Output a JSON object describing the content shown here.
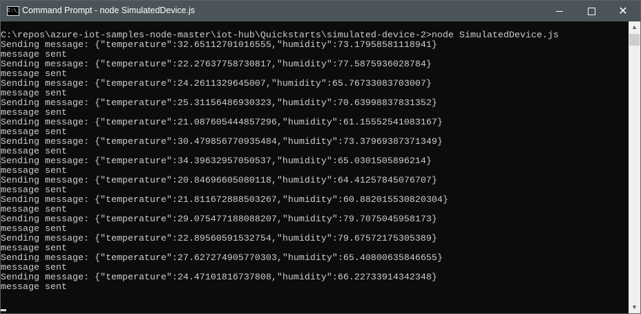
{
  "window": {
    "title": "Command Prompt - node  SimulatedDevice.js",
    "icon_text": "C:\\_"
  },
  "console": {
    "prompt": "C:\\repos\\azure-iot-samples-node-master\\iot-hub\\Quickstarts\\simulated-device-2>node SimulatedDevice.js",
    "lines": [
      "Sending message: {\"temperature\":32.65112701016555,\"humidity\":73.17958581118941}",
      "message sent",
      "Sending message: {\"temperature\":22.27637758730817,\"humidity\":77.5875936028784}",
      "message sent",
      "Sending message: {\"temperature\":24.2611329645007,\"humidity\":65.76733083703007}",
      "message sent",
      "Sending message: {\"temperature\":25.31156486930323,\"humidity\":70.63998837831352}",
      "message sent",
      "Sending message: {\"temperature\":21.087605444857296,\"humidity\":61.15552541083167}",
      "message sent",
      "Sending message: {\"temperature\":30.479856770935484,\"humidity\":73.37969387371349}",
      "message sent",
      "Sending message: {\"temperature\":34.39632957050537,\"humidity\":65.0301505896214}",
      "message sent",
      "Sending message: {\"temperature\":20.84696605080118,\"humidity\":64.41257845076707}",
      "message sent",
      "Sending message: {\"temperature\":21.811672888503267,\"humidity\":60.882015530820304}",
      "message sent",
      "Sending message: {\"temperature\":29.075477188088207,\"humidity\":79.7075045958173}",
      "message sent",
      "Sending message: {\"temperature\":22.89560591532754,\"humidity\":79.67572175305389}",
      "message sent",
      "Sending message: {\"temperature\":27.627274905770303,\"humidity\":65.40800635846655}",
      "message sent",
      "Sending message: {\"temperature\":24.47101816737808,\"humidity\":66.22733914342348}",
      "message sent"
    ]
  }
}
